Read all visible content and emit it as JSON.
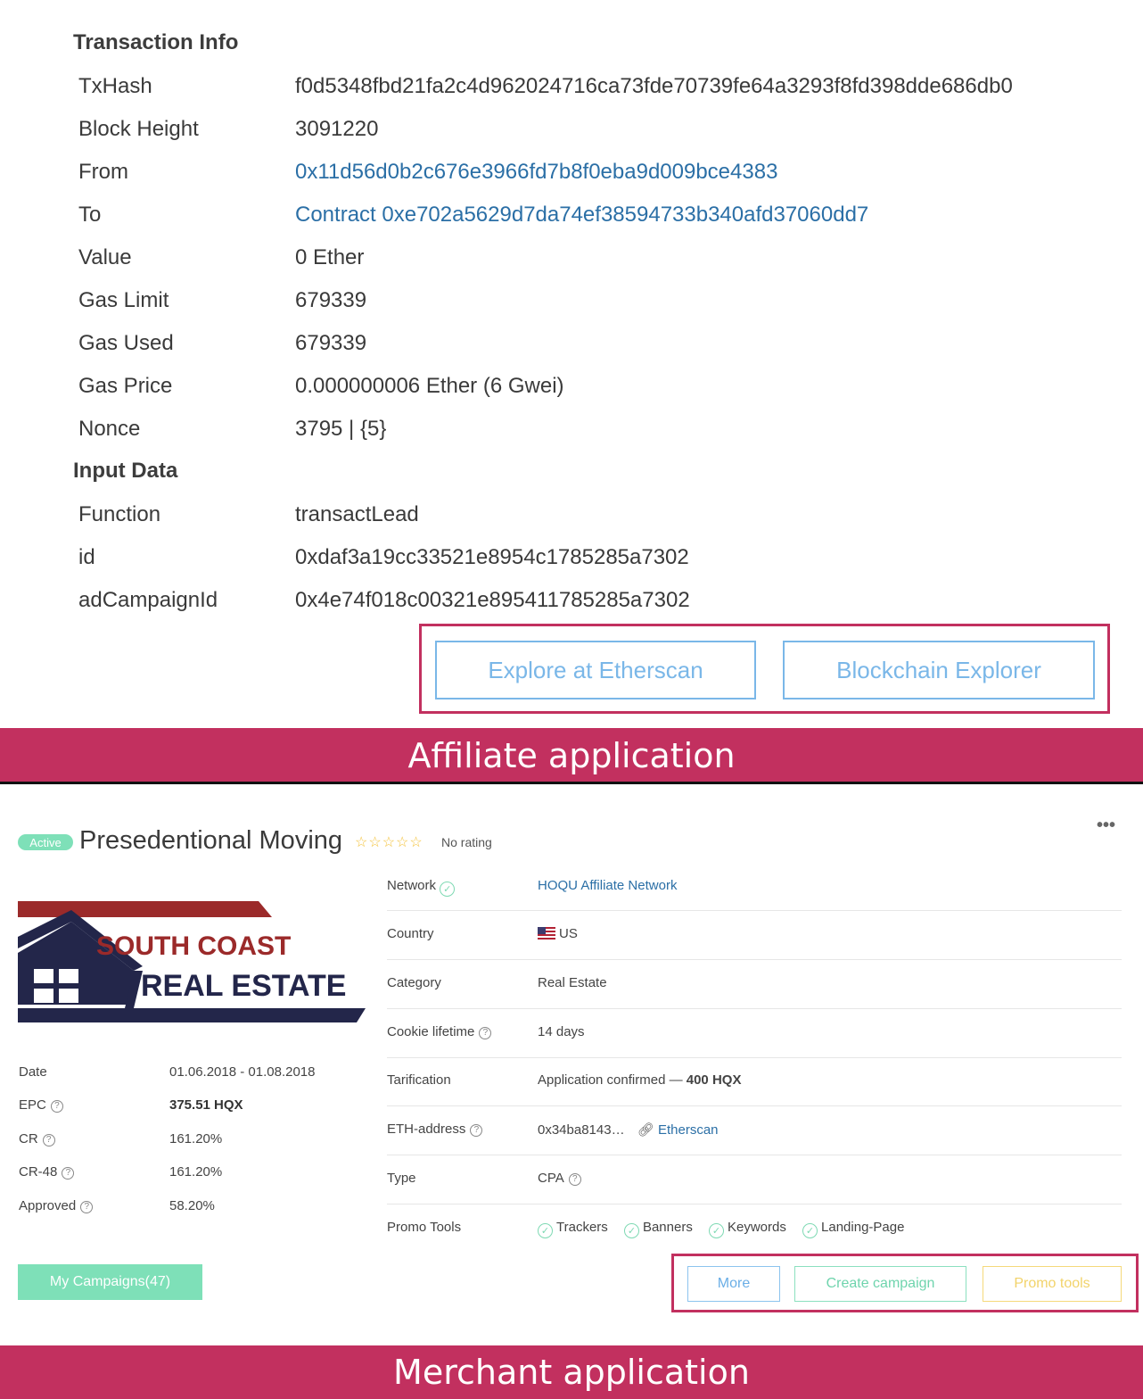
{
  "tx": {
    "heading_info": "Transaction Info",
    "rows": [
      {
        "k": "TxHash",
        "v": "f0d5348fbd21fa2c4d962024716ca73fde70739fe64a3293f8fd398dde686db0"
      },
      {
        "k": "Block Height",
        "v": "3091220"
      },
      {
        "k": "From",
        "v": "0x11d56d0b2c676e3966fd7b8f0eba9d009bce4383"
      },
      {
        "k": "To",
        "v": "Contract 0xe702a5629d7da74ef38594733b340afd37060dd7"
      },
      {
        "k": "Value",
        "v": "0 Ether"
      },
      {
        "k": "Gas Limit",
        "v": "679339"
      },
      {
        "k": "Gas Used",
        "v": "679339"
      },
      {
        "k": "Gas Price",
        "v": "0.000000006 Ether (6 Gwei)"
      },
      {
        "k": "Nonce",
        "v": "3795 | {5}"
      }
    ],
    "heading_input": "Input Data",
    "input_rows": [
      {
        "k": "Function",
        "v": "transactLead"
      },
      {
        "k": "id",
        "v": "0xdaf3a19cc33521e8954c1785285a7302"
      },
      {
        "k": "adCampaignId",
        "v": "0x4e74f018c00321e895411785285a7302"
      }
    ],
    "buttons": {
      "etherscan": "Explore at Etherscan",
      "explorer": "Blockchain Explorer"
    }
  },
  "banners": {
    "affiliate": "Affiliate application",
    "merchant": "Merchant application"
  },
  "offer": {
    "status": "Active",
    "title": "Presedentional Moving",
    "stars": "☆☆☆☆☆",
    "rating": "No rating",
    "more_menu": "•••",
    "logo": {
      "line1": "SOUTH COAST",
      "line2": "REAL ESTATE"
    },
    "stats": [
      {
        "k": "Date",
        "v": "01.06.2018 - 01.08.2018"
      },
      {
        "k": "EPC",
        "v": "375.51 HQX"
      },
      {
        "k": "CR",
        "v": "161.20%"
      },
      {
        "k": "CR-48",
        "v": "161.20%"
      },
      {
        "k": "Approved",
        "v": "58.20%"
      }
    ],
    "my_campaigns": "My Campaigns(47)",
    "props": {
      "network_k": "Network",
      "network_v": "HOQU Affiliate Network",
      "country_k": "Country",
      "country_v": "US",
      "category_k": "Category",
      "category_v": "Real Estate",
      "cookie_k": "Cookie lifetime",
      "cookie_v": "14 days",
      "tarif_k": "Tarification",
      "tarif_v": "Application confirmed — ",
      "tarif_amount": "400 HQX",
      "eth_k": "ETH-address",
      "eth_v": "0x34ba8143…",
      "eth_link": "Etherscan",
      "type_k": "Type",
      "type_v": "CPA",
      "promo_k": "Promo Tools",
      "promo_tools": [
        "Trackers",
        "Banners",
        "Keywords",
        "Landing-Page"
      ]
    },
    "buttons": {
      "more": "More",
      "create": "Create campaign",
      "promo": "Promo tools"
    },
    "colors": {
      "accent_green": "#7ee0b8",
      "link_blue": "#2b6fa6",
      "banner": "#c2305f",
      "yellow": "#f5d97a"
    }
  }
}
